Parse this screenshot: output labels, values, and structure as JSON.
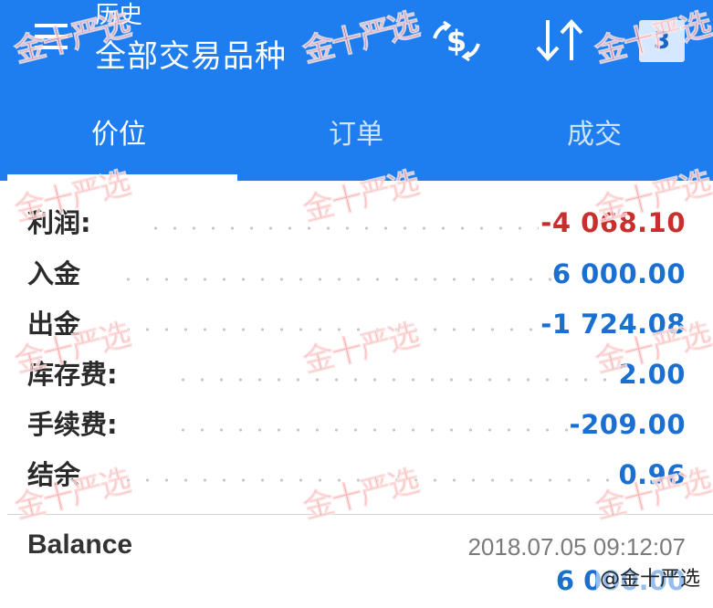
{
  "appbar": {
    "subtitle": "历史",
    "title": "全部交易品种",
    "period_badge": "3",
    "icons": {
      "menu": "hamburger-menu-icon",
      "currency": "dollar-exchange-icon",
      "sort": "sort-arrows-icon",
      "period": "calendar-period-icon"
    },
    "color": "#1e7ef0"
  },
  "tabs": [
    {
      "label": "价位",
      "active": true
    },
    {
      "label": "订单",
      "active": false
    },
    {
      "label": "成交",
      "active": false
    }
  ],
  "summary": [
    {
      "label": "利润:",
      "value": "-4 068.10",
      "color": "#c8302e"
    },
    {
      "label": "入金",
      "value": "6 000.00",
      "color": "#1a6fd0"
    },
    {
      "label": "出金",
      "value": "-1 724.08",
      "color": "#1a6fd0"
    },
    {
      "label": "库存费:",
      "value": "2.00",
      "color": "#1a6fd0"
    },
    {
      "label": "手续费:",
      "value": "-209.00",
      "color": "#1a6fd0"
    },
    {
      "label": "结余",
      "value": "0.96",
      "color": "#1a6fd0"
    }
  ],
  "balance": {
    "label": "Balance",
    "timestamp": "2018.07.05 09:12:07",
    "value": "6 000.00"
  },
  "watermark": {
    "text": "金十严选",
    "source": "@金十严选"
  }
}
